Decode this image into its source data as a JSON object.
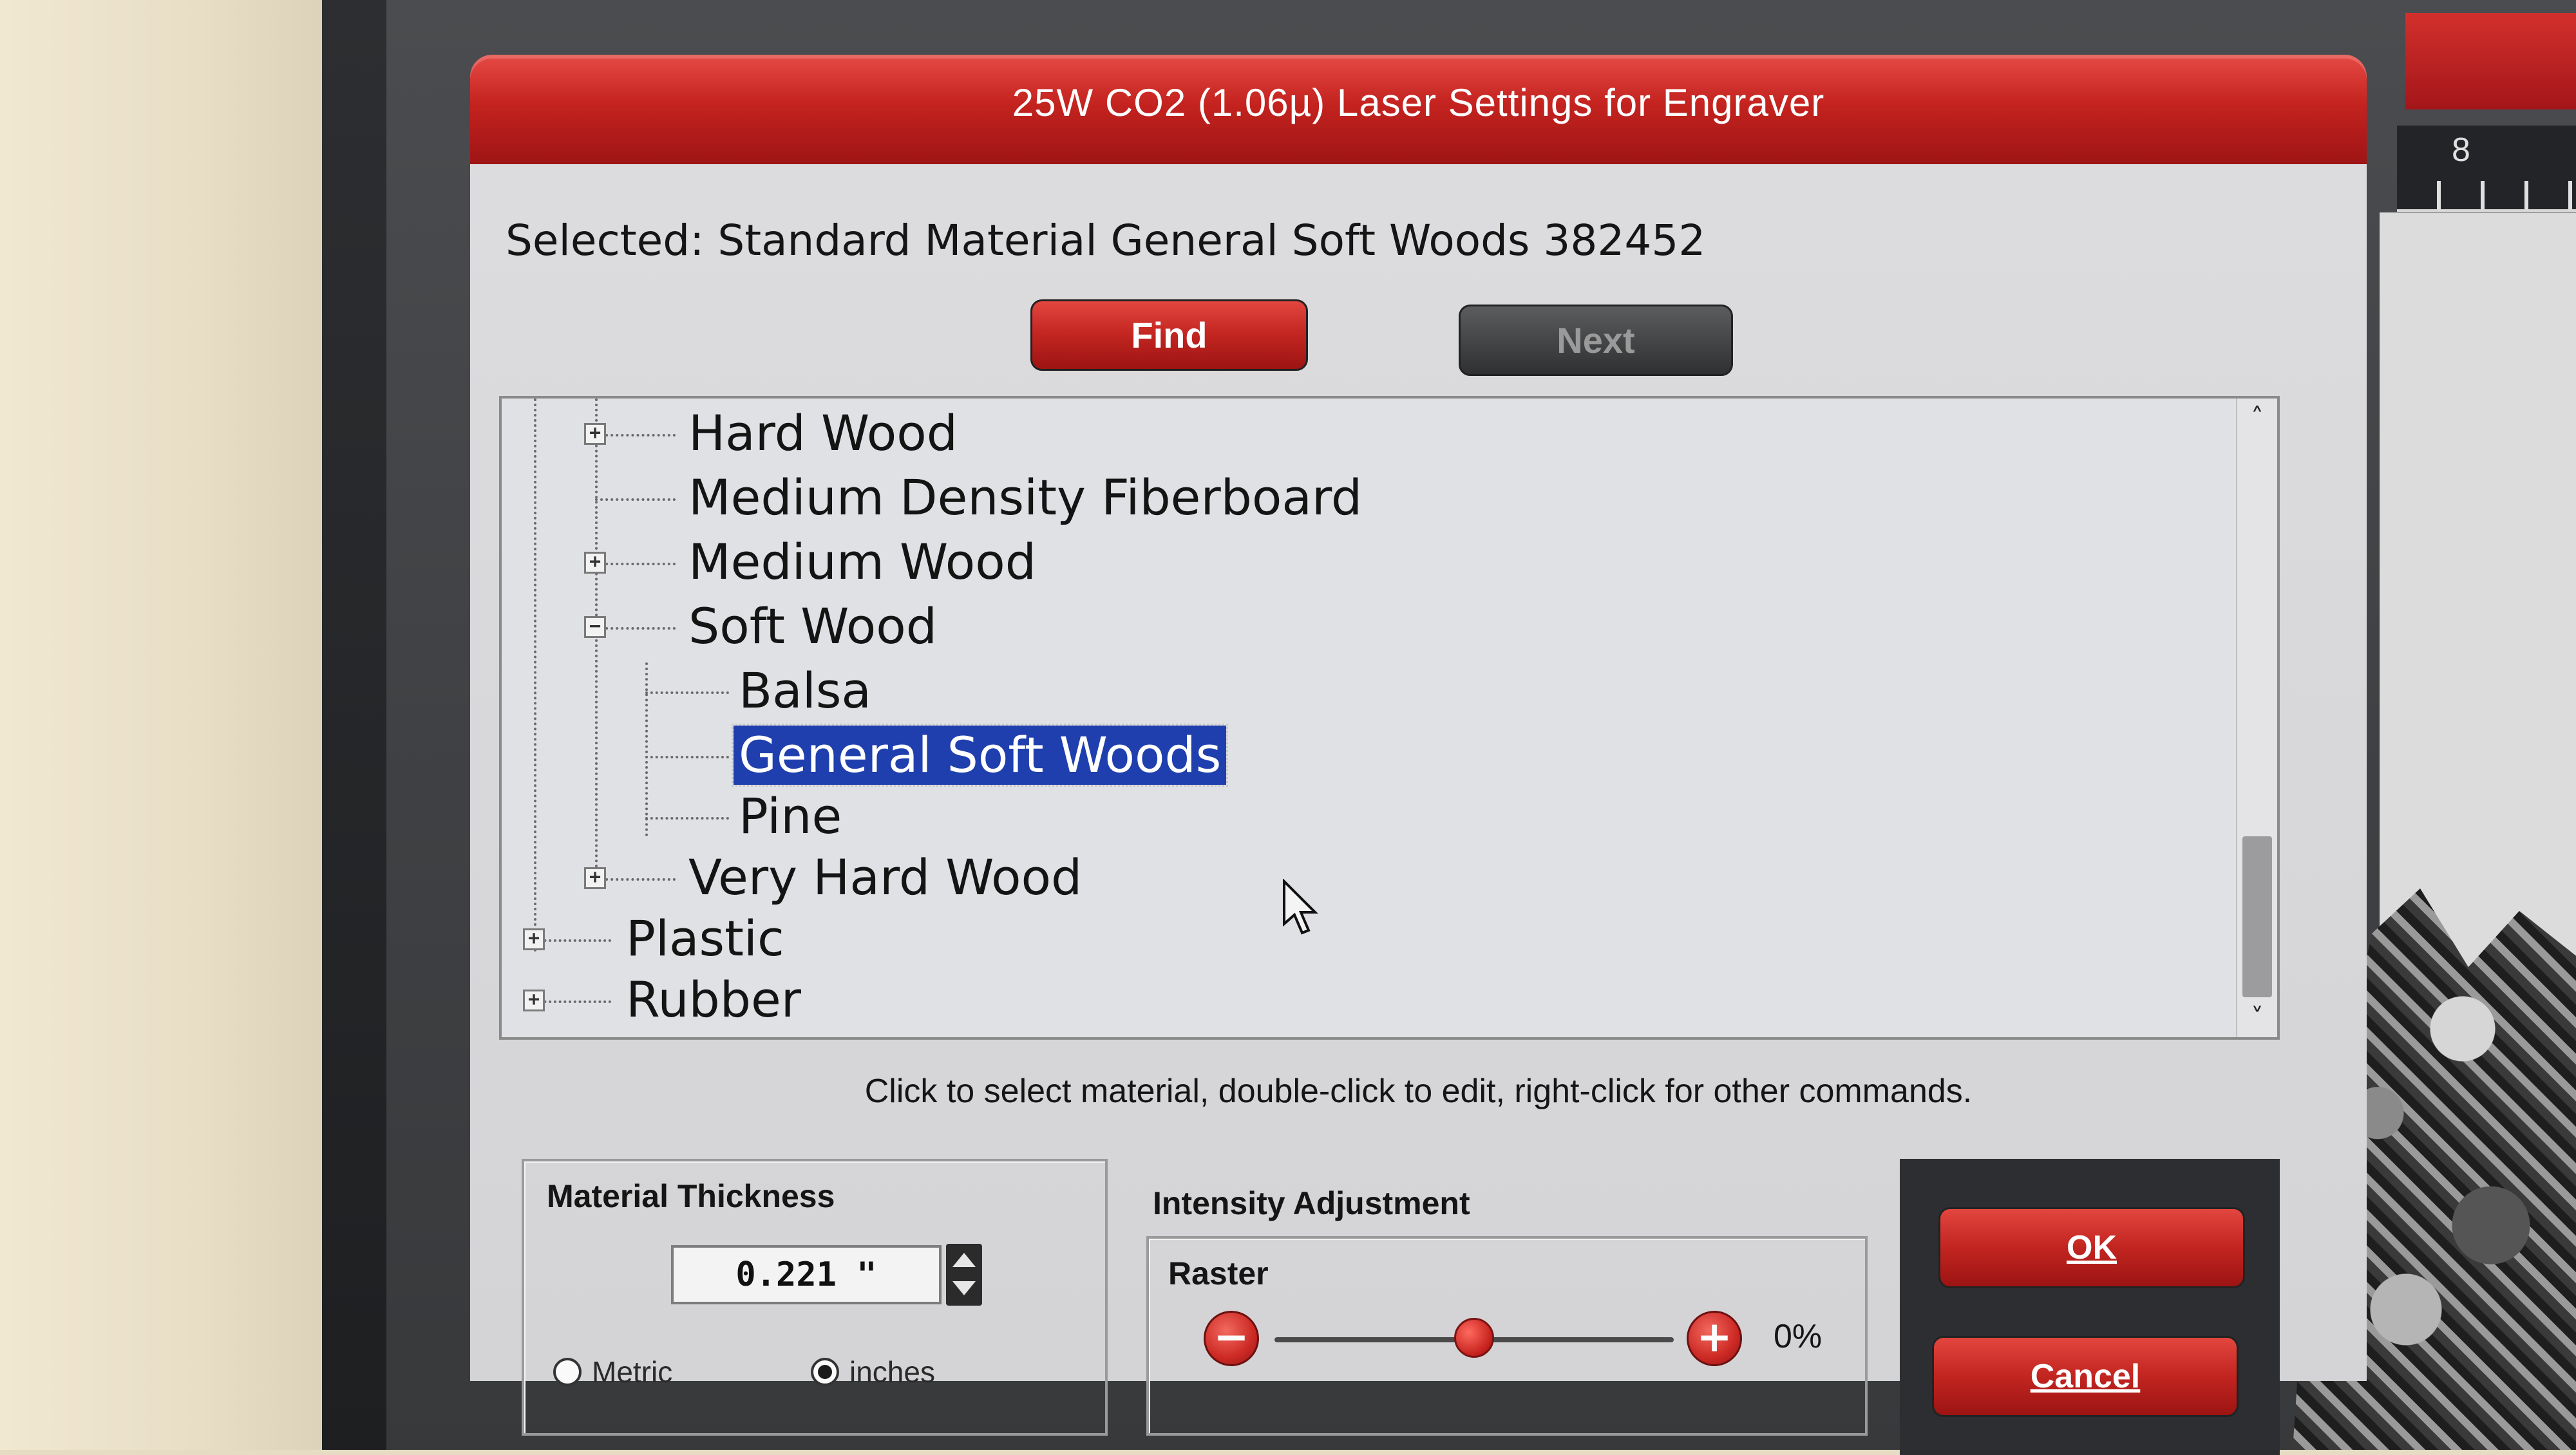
{
  "dialog": {
    "title": "25W CO2 (1.06µ) Laser Settings for Engraver",
    "selected_text": "Selected: Standard Material General Soft Woods 382452",
    "find_label": "Find",
    "next_label": "Next",
    "hint": "Click to select material, double-click to edit, right-click for other commands."
  },
  "background_ruler": {
    "mark": "8"
  },
  "tree": {
    "items": [
      {
        "label": "Hard Wood",
        "expander": "+"
      },
      {
        "label": "Medium Density Fiberboard",
        "expander": ""
      },
      {
        "label": "Medium Wood",
        "expander": "+"
      },
      {
        "label": "Soft Wood",
        "expander": "−"
      },
      {
        "label": "Balsa",
        "expander": ""
      },
      {
        "label": "General Soft Woods",
        "expander": "",
        "selected": true
      },
      {
        "label": "Pine",
        "expander": ""
      },
      {
        "label": "Very Hard Wood",
        "expander": "+"
      },
      {
        "label": "Plastic",
        "expander": "+"
      },
      {
        "label": "Rubber",
        "expander": "+"
      }
    ],
    "scroll_up": "˄",
    "scroll_down": "˅"
  },
  "thickness": {
    "title": "Material Thickness",
    "value": "0.221 \"",
    "metric_label": "Metric",
    "inches_label": "inches",
    "selected_unit": "inches"
  },
  "intensity": {
    "title": "Intensity Adjustment",
    "raster_label": "Raster",
    "minus": "−",
    "plus": "+",
    "value_text": "0%",
    "slider_fraction": 0.5
  },
  "actions": {
    "ok_label": "OK",
    "cancel_label": "Cancel"
  },
  "colors": {
    "title_red": "#c4231f",
    "selection_blue": "#1f3fae",
    "dialog_gray": "#d8d8da"
  }
}
